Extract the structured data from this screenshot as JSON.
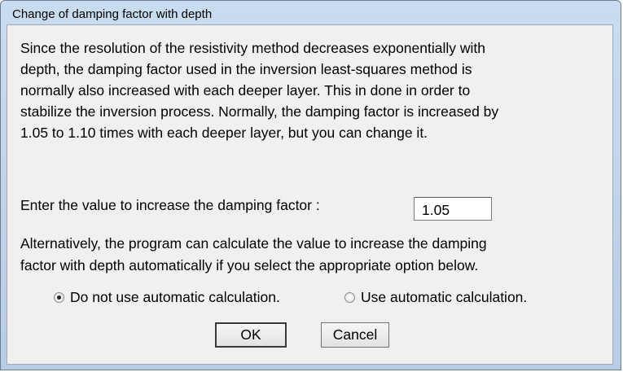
{
  "window": {
    "title": "Change of damping factor with depth"
  },
  "description": [
    "Since the resolution of the resistivity method decreases exponentially with",
    "depth, the damping factor used in the inversion least-squares method is",
    "normally also increased with each deeper layer. This in done in order to",
    "stabilize the inversion process. Normally, the damping factor is increased by",
    "1.05 to 1.10 times with each deeper layer, but you can change it."
  ],
  "factor": {
    "label": "Enter the value to increase the damping factor :",
    "value": "1.05"
  },
  "alternative": [
    "Alternatively, the program can calculate the value to increase the damping",
    "factor with depth automatically if you select the appropriate option below."
  ],
  "options": {
    "manual": {
      "label": "Do not use automatic calculation.",
      "selected": true
    },
    "auto": {
      "label": "Use automatic calculation.",
      "selected": false
    }
  },
  "buttons": {
    "ok": "OK",
    "cancel": "Cancel"
  }
}
